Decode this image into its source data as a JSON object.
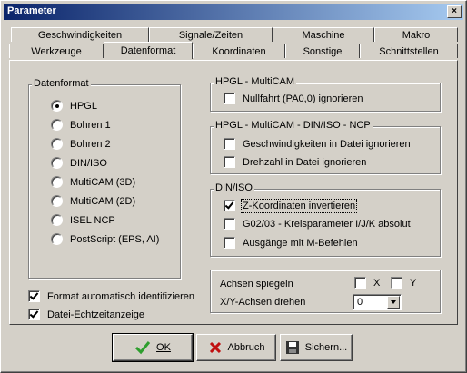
{
  "window": {
    "title": "Parameter",
    "close_label": "×"
  },
  "tabs_row1": [
    "Geschwindigkeiten",
    "Signale/Zeiten",
    "Maschine",
    "Makro"
  ],
  "tabs_row2": [
    "Werkzeuge",
    "Datenformat",
    "Koordinaten",
    "Sonstige",
    "Schnittstellen"
  ],
  "active_tab": "Datenformat",
  "datenformat": {
    "legend": "Datenformat",
    "options": [
      "HPGL",
      "Bohren 1",
      "Bohren 2",
      "DIN/ISO",
      "MultiCAM (3D)",
      "MultiCAM (2D)",
      "ISEL NCP",
      "PostScript (EPS, AI)"
    ],
    "selected": "HPGL"
  },
  "auto_detect": {
    "label": "Format automatisch identifizieren",
    "checked": true
  },
  "realtime_display": {
    "label": "Datei-Echtzeitanzeige",
    "checked": true
  },
  "hpgl_multicam": {
    "legend": "HPGL - MultiCAM",
    "items": [
      {
        "label": "Nullfahrt (PA0,0) ignorieren",
        "checked": false
      }
    ]
  },
  "hpgl_multicam_din": {
    "legend": "HPGL - MultiCAM - DIN/ISO - NCP",
    "items": [
      {
        "label": "Geschwindigkeiten in Datei ignorieren",
        "checked": false
      },
      {
        "label": "Drehzahl in Datei ignorieren",
        "checked": false
      }
    ]
  },
  "din_iso": {
    "legend": "DIN/ISO",
    "items": [
      {
        "label": "Z-Koordinaten invertieren",
        "checked": true
      },
      {
        "label": "G02/03 - Kreisparameter I/J/K absolut",
        "checked": false
      },
      {
        "label": "Ausgänge mit M-Befehlen",
        "checked": false
      }
    ]
  },
  "axes": {
    "mirror_label": "Achsen spiegeln",
    "x_label": "X",
    "x_checked": false,
    "y_label": "Y",
    "y_checked": false,
    "rotate_label": "X/Y-Achsen drehen",
    "rotate_value": "0"
  },
  "buttons": {
    "ok": "OK",
    "cancel": "Abbruch",
    "save": "Sichern..."
  },
  "colors": {
    "face": "#d4d0c8",
    "title_start": "#0a246a",
    "title_end": "#a6caf0",
    "ok_check": "#2e9e2e",
    "cancel_x": "#c01010"
  }
}
